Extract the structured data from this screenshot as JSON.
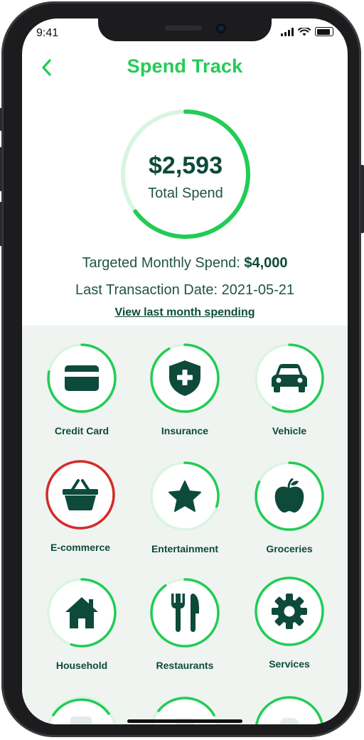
{
  "status_bar": {
    "time": "9:41"
  },
  "header": {
    "title": "Spend Track",
    "back_icon": "chevron-left-icon"
  },
  "summary": {
    "total_amount": "$2,593",
    "total_label": "Total Spend",
    "spend_fraction": 0.648,
    "targeted_label": "Targeted Monthly Spend: ",
    "targeted_value": "$4,000",
    "last_txn_label": "Last Transaction Date: ",
    "last_txn_value": "2021-05-21",
    "view_link": "View last month spending"
  },
  "colors": {
    "accent": "#22cc55",
    "dark": "#0d4a3a",
    "alert": "#d42a2a",
    "track": "#d8f5e1",
    "panel": "#eff4f1"
  },
  "categories": [
    {
      "label": "Credit Card",
      "icon": "credit-card-icon",
      "fraction": 0.78,
      "color": "#22cc55"
    },
    {
      "label": "Insurance",
      "icon": "shield-plus-icon",
      "fraction": 0.92,
      "color": "#22cc55"
    },
    {
      "label": "Vehicle",
      "icon": "car-icon",
      "fraction": 0.58,
      "color": "#22cc55"
    },
    {
      "label": "E-commerce",
      "icon": "basket-icon",
      "fraction": 1.0,
      "color": "#d42a2a"
    },
    {
      "label": "Entertainment",
      "icon": "star-icon",
      "fraction": 0.3,
      "color": "#22cc55"
    },
    {
      "label": "Groceries",
      "icon": "apple-icon",
      "fraction": 0.82,
      "color": "#22cc55"
    },
    {
      "label": "Household",
      "icon": "house-icon",
      "fraction": 0.55,
      "color": "#22cc55"
    },
    {
      "label": "Restaurants",
      "icon": "fork-knife-icon",
      "fraction": 0.9,
      "color": "#22cc55"
    },
    {
      "label": "Services",
      "icon": "gear-icon",
      "fraction": 1.0,
      "color": "#22cc55"
    }
  ]
}
